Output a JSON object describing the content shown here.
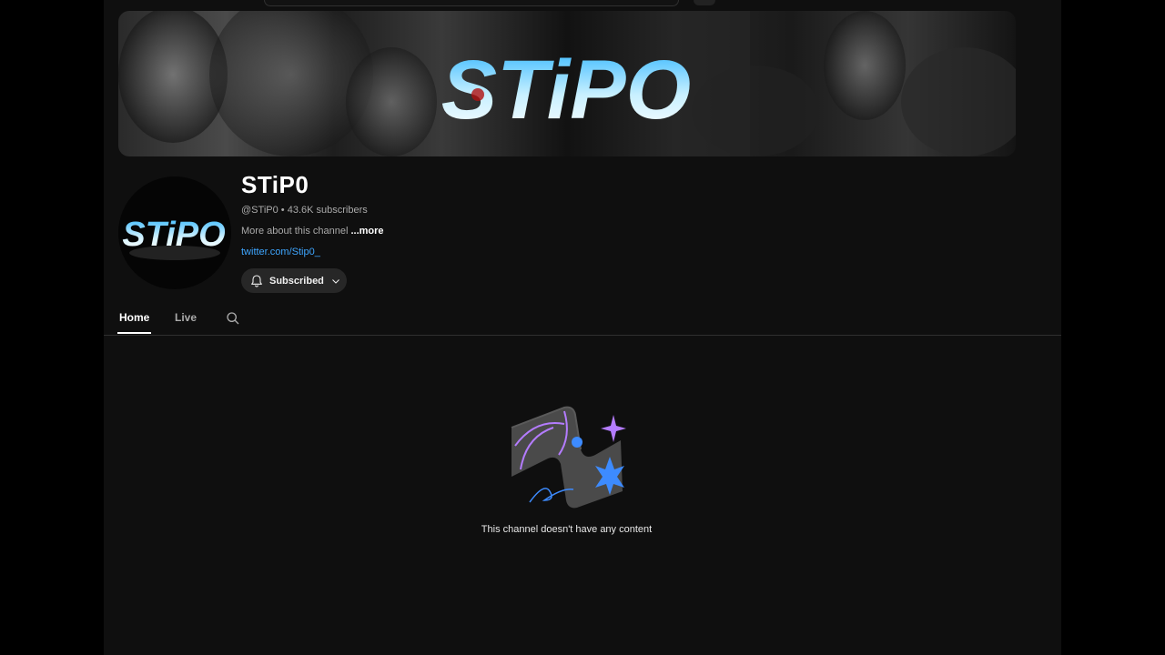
{
  "channel": {
    "name": "STiP0",
    "handle": "@STiP0",
    "separator": "•",
    "subscribers": "43.6K subscribers",
    "about_text": "More about this channel",
    "about_more": "...more",
    "link": "twitter.com/Stip0_",
    "banner_logo_text": "STiPO",
    "avatar_logo_text": "STiPO"
  },
  "subscribe_button": {
    "label": "Subscribed",
    "icon": "bell-icon",
    "dropdown_icon": "chevron-down-icon"
  },
  "tabs": [
    {
      "label": "Home",
      "active": true
    },
    {
      "label": "Live",
      "active": false
    }
  ],
  "tab_search_icon": "search-icon",
  "empty_state": {
    "message": "This channel doesn't have any content"
  },
  "colors": {
    "background": "#0f0f0f",
    "outer": "#000000",
    "link": "#3ea6ff",
    "logo_cyan": "#8fe3ff",
    "illustration_purple": "#b47cff",
    "illustration_blue": "#3d8bff"
  }
}
